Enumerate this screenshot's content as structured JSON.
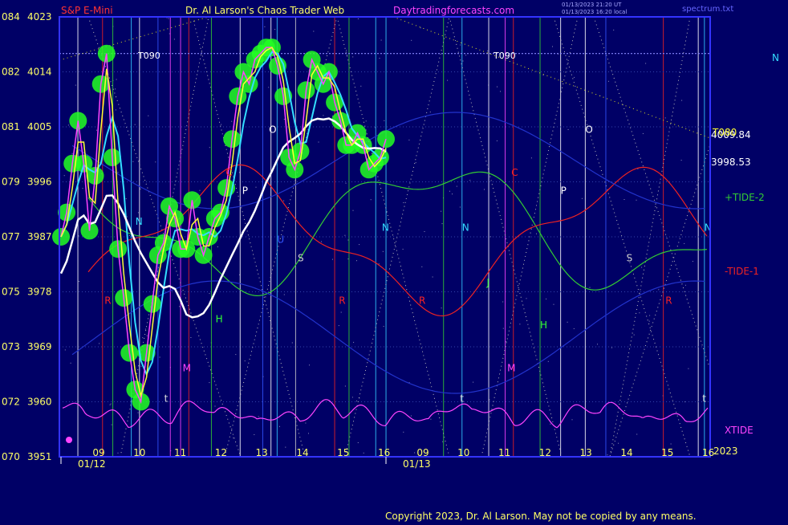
{
  "header": {
    "symbol": "S&P E-Mini",
    "title": "Dr. Al Larson's Chaos Trader Web",
    "site": "Daytradingforecasts.com",
    "stamp1": "01/13/2023 21:20 UT",
    "stamp2": "01/13/2023 16:20 local",
    "file": "spectrum.txt"
  },
  "footer": {
    "copyright": "Copyright 2023, Dr. Al Larson. May not be copied by any means."
  },
  "colors": {
    "background": "#000066",
    "frame": "#3333ff",
    "price_glow": "#22ff22",
    "price_line": "#ffff33",
    "fast_avg": "#ff44ff",
    "cyan_avg": "#33ddff",
    "white_avg": "#ffffff",
    "tide_plus": "#33cc33",
    "tide_minus": "#ee2222",
    "xtide": "#ff44ff",
    "dotted_white": "#bbbbbb",
    "dotted_yellow": "#dddd22",
    "t090_line": "#8888ff",
    "symbol_text": "#ff3333",
    "title_text": "#ffff66",
    "site_text": "#ff44ff",
    "stamp_text": "#aaaaff",
    "file_text": "#6666ff",
    "axis_text": "#ffff66",
    "copyright_text": "#ffff66"
  },
  "chart_data": {
    "type": "line",
    "title": "S&P E-Mini",
    "y_labels": [
      {
        "left": "084",
        "right": "4023",
        "price": 4023
      },
      {
        "left": "082",
        "right": "4014",
        "price": 4014
      },
      {
        "left": "081",
        "right": "4005",
        "price": 4005
      },
      {
        "left": "079",
        "right": "3996",
        "price": 3996
      },
      {
        "left": "077",
        "right": "3987",
        "price": 3987
      },
      {
        "left": "075",
        "right": "3978",
        "price": 3978
      },
      {
        "left": "073",
        "right": "3969",
        "price": 3969
      },
      {
        "left": "072",
        "right": "3960",
        "price": 3960
      },
      {
        "left": "070",
        "right": "3951",
        "price": 3951
      }
    ],
    "ylim": [
      3951,
      4023
    ],
    "x_hours": [
      "09",
      "10",
      "11",
      "12",
      "13",
      "14",
      "15",
      "16",
      "09",
      "10",
      "11",
      "12",
      "13",
      "14",
      "15",
      "16"
    ],
    "x_dates": [
      "01/12",
      "01/13"
    ],
    "x_year": "2023",
    "price_series": [
      3987,
      3991,
      3999,
      4006,
      3999,
      3988,
      3997,
      4012,
      4017,
      4000,
      3985,
      3977,
      3968,
      3962,
      3960,
      3968,
      3976,
      3984,
      3986,
      3992,
      3990,
      3985,
      3985,
      3993,
      3987,
      3984,
      3987,
      3990,
      3991,
      3995,
      4003,
      4010,
      4014,
      4012,
      4016,
      4017,
      4018,
      4018,
      4015,
      4010,
      4000,
      3998,
      4001,
      4011,
      4016,
      4014,
      4012,
      4014,
      4009,
      4006,
      4002,
      4002,
      4004,
      4002,
      3998,
      3999,
      4000,
      4003
    ],
    "reference_lines": [
      {
        "label": "T090",
        "price": 4017
      },
      {
        "label": "4009.84",
        "price": 4004
      },
      {
        "label": "T080",
        "price": 4004
      },
      {
        "label": "3998.53",
        "price": 3999
      }
    ],
    "right_labels": [
      {
        "text": "+TIDE-2",
        "series": "tide_plus"
      },
      {
        "text": "-TIDE-1",
        "series": "tide_minus"
      },
      {
        "text": "XTIDE",
        "series": "xtide"
      },
      {
        "text": "N",
        "series": "marker"
      }
    ],
    "markers": [
      {
        "text": "C",
        "hour": 12.2,
        "price": 3997,
        "color": "#ff2222"
      },
      {
        "text": "P",
        "hour": 12.6,
        "price": 3994,
        "color": "#ffffff"
      },
      {
        "text": "O",
        "hour": 13.25,
        "price": 4004,
        "color": "#ffffff"
      },
      {
        "text": "N",
        "hour": 10.0,
        "price": 3989,
        "color": "#33ddff"
      },
      {
        "text": "U",
        "hour": 13.45,
        "price": 3986,
        "color": "#3355ff"
      },
      {
        "text": "S",
        "hour": 13.95,
        "price": 3983,
        "color": "#cccccc"
      },
      {
        "text": "R",
        "hour": 9.25,
        "price": 3976,
        "color": "#ff2222"
      },
      {
        "text": "R",
        "hour": 14.95,
        "price": 3976,
        "color": "#ff2222"
      },
      {
        "text": "H",
        "hour": 11.95,
        "price": 3973,
        "color": "#33ff33"
      },
      {
        "text": "M",
        "hour": 11.15,
        "price": 3965,
        "color": "#ff44ff"
      },
      {
        "text": "t",
        "hour": 10.7,
        "price": 3960,
        "color": "#dddddd"
      },
      {
        "text": "N",
        "hour": 16.0,
        "price": 3988,
        "color": "#33ddff"
      },
      {
        "text": "R",
        "hour": 16.9,
        "price": 3976,
        "color": "#ff2222"
      },
      {
        "text": "N",
        "hour": 17.95,
        "price": 3988,
        "color": "#33ddff"
      },
      {
        "text": "C",
        "hour": 19.15,
        "price": 3997,
        "color": "#ff2222"
      },
      {
        "text": "J",
        "hour": 18.55,
        "price": 3979,
        "color": "#33ff33"
      },
      {
        "text": "M",
        "hour": 19.05,
        "price": 3965,
        "color": "#ff44ff"
      },
      {
        "text": "t",
        "hour": 17.9,
        "price": 3960,
        "color": "#dddddd"
      },
      {
        "text": "H",
        "hour": 19.85,
        "price": 3972,
        "color": "#33ff33"
      },
      {
        "text": "O",
        "hour": 20.95,
        "price": 4004,
        "color": "#ffffff"
      },
      {
        "text": "P",
        "hour": 20.35,
        "price": 3994,
        "color": "#ffffff"
      },
      {
        "text": "S",
        "hour": 21.95,
        "price": 3983,
        "color": "#cccccc"
      },
      {
        "text": "R",
        "hour": 22.9,
        "price": 3976,
        "color": "#ff2222"
      },
      {
        "text": "N",
        "hour": 23.85,
        "price": 3988,
        "color": "#33ddff"
      },
      {
        "text": "t",
        "hour": 23.8,
        "price": 3960,
        "color": "#dddddd"
      }
    ],
    "vertical_lines": [
      {
        "hour": 8.6,
        "color": "#ffffff"
      },
      {
        "hour": 9.2,
        "color": "#ee2222"
      },
      {
        "hour": 9.45,
        "color": "#33cc33"
      },
      {
        "hour": 9.9,
        "color": "#33ccff"
      },
      {
        "hour": 10.1,
        "color": "#ffffff"
      },
      {
        "hour": 10.55,
        "color": "#3355ff"
      },
      {
        "hour": 10.85,
        "color": "#ff44ff"
      },
      {
        "hour": 11.1,
        "color": "#ff44ff"
      },
      {
        "hour": 11.3,
        "color": "#ee2222"
      },
      {
        "hour": 11.85,
        "color": "#33cc33"
      },
      {
        "hour": 12.55,
        "color": "#ffffff"
      },
      {
        "hour": 13.1,
        "color": "#3355ff"
      },
      {
        "hour": 13.3,
        "color": "#ffffff"
      },
      {
        "hour": 13.45,
        "color": "#33ccff"
      },
      {
        "hour": 13.9,
        "color": "#cccccc"
      },
      {
        "hour": 14.85,
        "color": "#ee2222"
      },
      {
        "hour": 15.2,
        "color": "#33cc33"
      },
      {
        "hour": 15.85,
        "color": "#33ccff"
      },
      {
        "hour": 16.1,
        "color": "#33ccff"
      },
      {
        "hour": 17.5,
        "color": "#33cc33"
      },
      {
        "hour": 17.95,
        "color": "#33ccff"
      },
      {
        "hour": 18.6,
        "color": "#ffffff"
      },
      {
        "hour": 19.0,
        "color": "#ff44ff"
      },
      {
        "hour": 19.2,
        "color": "#ee2222"
      },
      {
        "hour": 19.85,
        "color": "#33cc33"
      },
      {
        "hour": 20.35,
        "color": "#ffffff"
      },
      {
        "hour": 20.95,
        "color": "#ffffff"
      },
      {
        "hour": 21.45,
        "color": "#3355ff"
      },
      {
        "hour": 22.85,
        "color": "#ee2222"
      },
      {
        "hour": 23.7,
        "color": "#ffffff"
      },
      {
        "hour": 23.85,
        "color": "#33ccff"
      }
    ]
  }
}
